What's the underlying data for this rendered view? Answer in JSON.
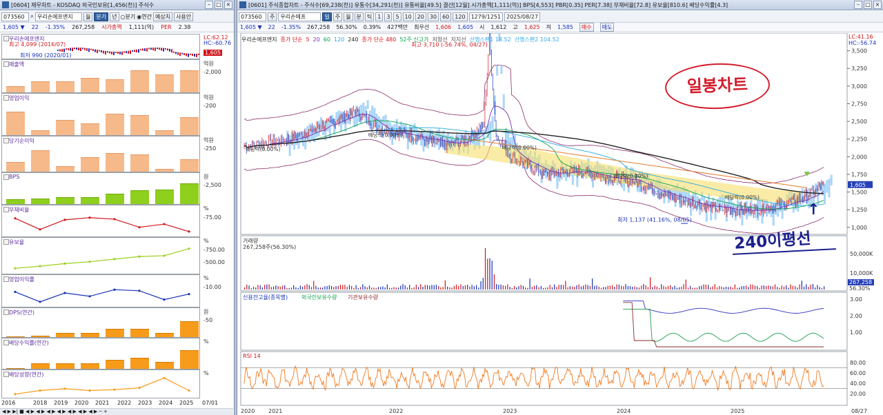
{
  "left": {
    "title": "[0604] 재무차트 - KOSDAQ 외국인보유[1,456(천)] 주식수",
    "code": "073560",
    "name": "우리손에프앤지",
    "toggle_labels": [
      "월",
      "분기",
      "년"
    ],
    "radio_labels": [
      "분기",
      "연간"
    ],
    "right_btns": [
      "예상치",
      "사용안"
    ],
    "quote": {
      "price": "1,605",
      "change": "22",
      "pct": "-1.35%",
      "volume": "267,258",
      "mcap_label": "시가총액",
      "mcap": "1,111(억)",
      "per_label": "PER",
      "per": "2.38"
    },
    "panels": [
      {
        "title": "우리손에프앤지",
        "sub": "최고 4,099 (2016/07)",
        "sub2": "최저 990 (2020/01)"
      },
      {
        "title": "매출액",
        "unit": "억원",
        "ticks": [
          "2,000"
        ],
        "values": [
          0.25,
          0.45,
          0.45,
          0.6,
          0.55,
          0.9,
          0.75,
          0.9
        ]
      },
      {
        "title": "영업이익",
        "unit": "억원",
        "ticks": [
          "200"
        ],
        "values": [
          0.7,
          0.15,
          0.45,
          0.35,
          0.65,
          0.6,
          0.15,
          0.55
        ]
      },
      {
        "title": "당기순이익",
        "unit": "억원",
        "ticks": [
          "250"
        ],
        "values": [
          0.35,
          0.8,
          0.2,
          0.55,
          0.7,
          0.65,
          0.1,
          0.45
        ]
      },
      {
        "title": "BPS",
        "unit": "원",
        "ticks": [
          "2,500"
        ],
        "values": [
          0.22,
          0.25,
          0.3,
          0.3,
          0.45,
          0.6,
          0.65,
          0.9
        ]
      },
      {
        "title": "부채비율",
        "unit": "%",
        "ticks": [
          "75.00"
        ],
        "values": [
          0.72,
          0.2,
          0.65,
          0.75,
          0.68,
          0.3,
          0.45,
          0.1
        ]
      },
      {
        "title": "유보율",
        "unit": "%",
        "ticks": [
          "750.00",
          "500.00"
        ],
        "values": [
          0.1,
          0.18,
          0.28,
          0.35,
          0.45,
          0.55,
          0.58,
          0.85
        ]
      },
      {
        "title": "영업이익률",
        "unit": "%",
        "ticks": [
          "10.00"
        ],
        "values": [
          0.55,
          0.1,
          0.5,
          0.35,
          0.65,
          0.6,
          0.2,
          0.45
        ]
      },
      {
        "title": "DPS(연간)",
        "unit": "원",
        "ticks": [
          "50"
        ],
        "values": [
          0.0,
          0.05,
          0.2,
          0.2,
          0.4,
          0.4,
          0.2,
          0.75
        ]
      },
      {
        "title": "배당수익률(연간)",
        "unit": "%",
        "ticks": [],
        "values": [
          0.0,
          0.25,
          0.25,
          0.25,
          0.4,
          0.5,
          0.3,
          0.85
        ]
      },
      {
        "title": "배당성향(연간)",
        "unit": "%",
        "ticks": [],
        "values": [
          0.05,
          0.25,
          0.35,
          0.25,
          0.3,
          0.4,
          0.95,
          0.25
        ]
      }
    ],
    "hlc": {
      "lc": "LC:62.12",
      "hc": "HC:-60.76",
      "price_tag": "1,605"
    },
    "years": [
      "2016",
      "2018",
      "2019",
      "2020",
      "2021",
      "2022",
      "2023",
      "2024",
      "2025",
      "07/01"
    ]
  },
  "right": {
    "title": "[0601] 주식종합차트 - 주식수[69,238(천)] 유통수[34,291(천)] 유통비율[49.5] 결산[12월] 시가총액[1,111(억)] BPS[4,553] PBR[0.35] PER[7.38] 부채비율[72.8] 유보율[810.6] 배당수익률[4.3]",
    "code": "073560",
    "type": "주",
    "name": "우리손에프",
    "period_btns": [
      "일",
      "주",
      "월",
      "분",
      "틱",
      "1",
      "3",
      "5",
      "10",
      "20",
      "30",
      "60",
      "120"
    ],
    "count": "1279/1251",
    "date": "2025/08/27",
    "quote": {
      "price": "1,605",
      "change": "22",
      "pct": "-1.35%",
      "volume": "267,258",
      "vol_pct": "56.30%",
      "turn": "0.39%",
      "amount": "427백만",
      "best": "최우선",
      "bid": "1,606",
      "ask": "1,605",
      "open_l": "시",
      "open": "1,612",
      "high_l": "고",
      "high": "1,625",
      "low_l": "저",
      "low": "1,585",
      "buy": "매수",
      "sell": "매도"
    },
    "legend": [
      "우리손에프앤지",
      "종가 단순",
      "5",
      "20",
      "60",
      "120",
      "240",
      "종가 단순 480",
      "52주 신고가",
      "저항선",
      "지지선",
      "선행스팬1 18.52",
      "선행스팬2 104.52"
    ],
    "hlc": {
      "lc": "LC:41.16",
      "hc": "HC:-56.74",
      "price_tag": "1,605"
    },
    "max_label": "최고 3,710 (-56.74%, 04/27)",
    "min_label": "최저 1,137 (41.16%, 08/05)",
    "div_labels": [
      "배당락(0.00%)",
      "배당락(0.00%)",
      "배당락(0.00%)",
      "배당락(0.00%)",
      "배당락(0.00%)"
    ],
    "price_axis": [
      "3,500",
      "3,250",
      "3,000",
      "2,750",
      "2,500",
      "2,250",
      "2,000",
      "1,750",
      "1,500",
      "1,250",
      "1,000"
    ],
    "vol": {
      "title": "거래량",
      "value": "267,258주(56.30%)",
      "axis": [
        "50,000K",
        "10,000K"
      ],
      "tag": "267,258",
      "tag2": "56.30%"
    },
    "credit": {
      "title": "신용잔고율(종목별)",
      "s2": "외국인보유수량",
      "s3": "기관보유수량",
      "axis": [
        "3.00",
        "2.00",
        "1.00"
      ]
    },
    "rsi": {
      "title": "RSI 14",
      "axis": [
        "80.00",
        "60.00",
        "40.00",
        "20.00"
      ]
    },
    "years": [
      "2020",
      "2021",
      "2022",
      "2023",
      "2024",
      "2025",
      "08/27"
    ],
    "annotation1": "일봉차트",
    "annotation2": "240이평선"
  },
  "colors": {
    "up": "#d0141b",
    "down": "#1631b8",
    "volume_up": "#d0141b",
    "rsi": "#f0781e",
    "annotation_red": "#d41b2a",
    "annotation_blue": "#1a1f8c",
    "ma240": "#8b6a00",
    "band": "#f6e06a"
  }
}
